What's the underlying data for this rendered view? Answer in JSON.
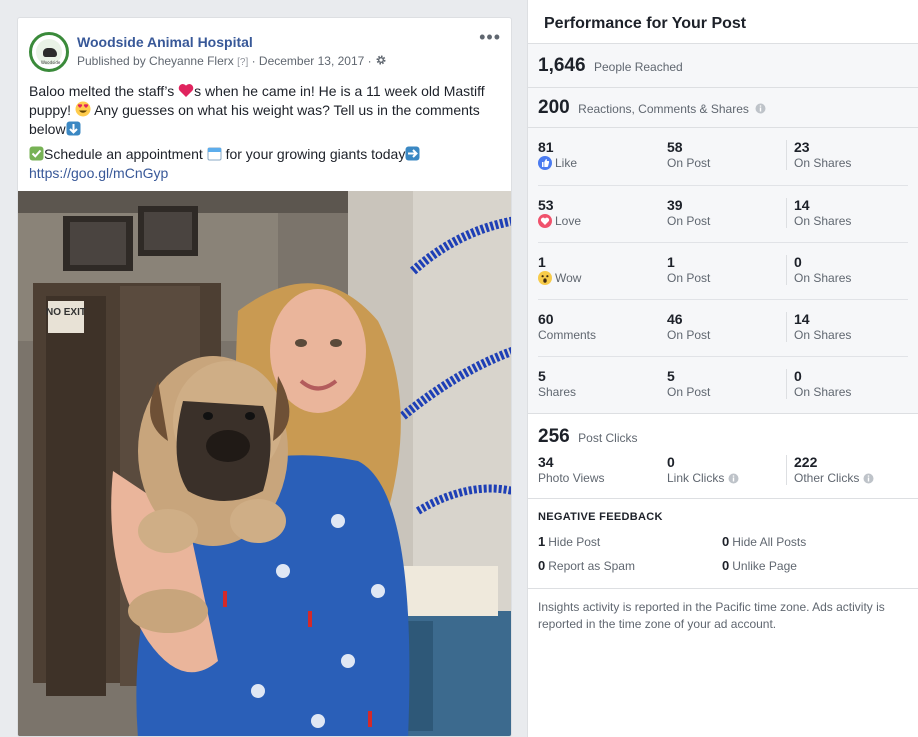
{
  "post": {
    "page_name": "Woodside Animal Hospital",
    "avatar_text": "Woodside",
    "published_by": "Published by Cheyanne Flerx",
    "question_mark": "[?]",
    "date": "· December 13, 2017 ·",
    "more": "•••",
    "text1_a": "Baloo melted the staff’s",
    "text1_b": "s when he came in! He is a 11 week old Mastiff puppy!",
    "text1_c": "Any guesses on what his weight was? Tell us in the comments below",
    "text2_a": "Schedule an appointment",
    "text2_b": "for your growing giants today",
    "link": "https://goo.gl/mCnGyp",
    "photo_signs": {
      "no_exit": "NO EXIT"
    }
  },
  "performance": {
    "title": "Performance for Your Post",
    "reached_num": "1,646",
    "reached_label": "People Reached",
    "engagement_num": "200",
    "engagement_label": "Reactions, Comments & Shares",
    "rows": [
      {
        "total": "81",
        "label": "Like",
        "on_post": "58",
        "on_post_label": "On Post",
        "on_shares": "23",
        "on_shares_label": "On Shares"
      },
      {
        "total": "53",
        "label": "Love",
        "on_post": "39",
        "on_post_label": "On Post",
        "on_shares": "14",
        "on_shares_label": "On Shares"
      },
      {
        "total": "1",
        "label": "Wow",
        "on_post": "1",
        "on_post_label": "On Post",
        "on_shares": "0",
        "on_shares_label": "On Shares"
      },
      {
        "total": "60",
        "label": "Comments",
        "on_post": "46",
        "on_post_label": "On Post",
        "on_shares": "14",
        "on_shares_label": "On Shares"
      },
      {
        "total": "5",
        "label": "Shares",
        "on_post": "5",
        "on_post_label": "On Post",
        "on_shares": "0",
        "on_shares_label": "On Shares"
      }
    ],
    "clicks_num": "256",
    "clicks_label": "Post Clicks",
    "clicks": [
      {
        "num": "34",
        "label": "Photo Views"
      },
      {
        "num": "0",
        "label": "Link Clicks"
      },
      {
        "num": "222",
        "label": "Other Clicks"
      }
    ],
    "negative_title": "NEGATIVE FEEDBACK",
    "negative": [
      {
        "num": "1",
        "label": "Hide Post"
      },
      {
        "num": "0",
        "label": "Hide All Posts"
      },
      {
        "num": "0",
        "label": "Report as Spam"
      },
      {
        "num": "0",
        "label": "Unlike Page"
      }
    ],
    "footnote": "Insights activity is reported in the Pacific time zone. Ads activity is reported in the time zone of your ad account."
  },
  "colors": {
    "link_blue": "#385898",
    "like_blue": "#4b7bf0",
    "love_red": "#f0526c",
    "wow_yellow": "#f7cb4a"
  }
}
